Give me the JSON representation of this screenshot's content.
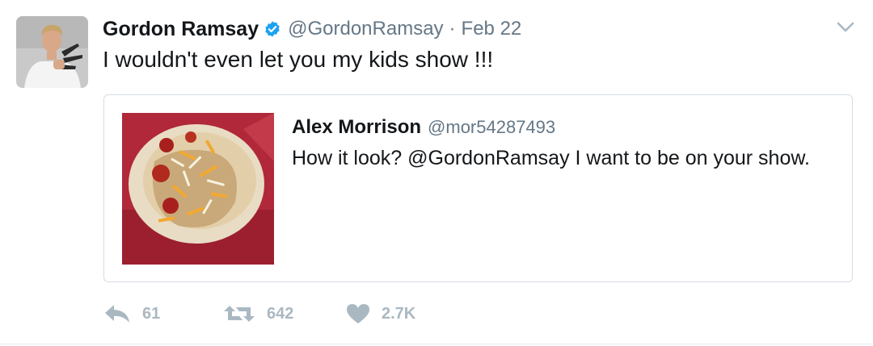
{
  "tweet": {
    "author": {
      "display_name": "Gordon Ramsay",
      "handle": "@GordonRamsay",
      "verified": true,
      "avatar_icon": "chef-with-knives-photo"
    },
    "separator": "·",
    "date": "Feb 22",
    "text": "I wouldn't even let you my kids show !!!",
    "menu_icon": "chevron-down-icon"
  },
  "quoted_tweet": {
    "author": {
      "display_name": "Alex Morrison",
      "handle": "@mor54287493"
    },
    "text": "How it look? @GordonRamsay I want to be on your show.",
    "media_icon": "tortilla-food-photo"
  },
  "actions": {
    "reply": {
      "icon": "reply-icon",
      "count": "61"
    },
    "retweet": {
      "icon": "retweet-icon",
      "count": "642"
    },
    "like": {
      "icon": "heart-icon",
      "count": "2.7K"
    }
  },
  "colors": {
    "text_primary": "#14171a",
    "text_secondary": "#657786",
    "action_gray": "#aab8c2",
    "verified_blue": "#1da1f2",
    "border": "#d6dde3"
  }
}
